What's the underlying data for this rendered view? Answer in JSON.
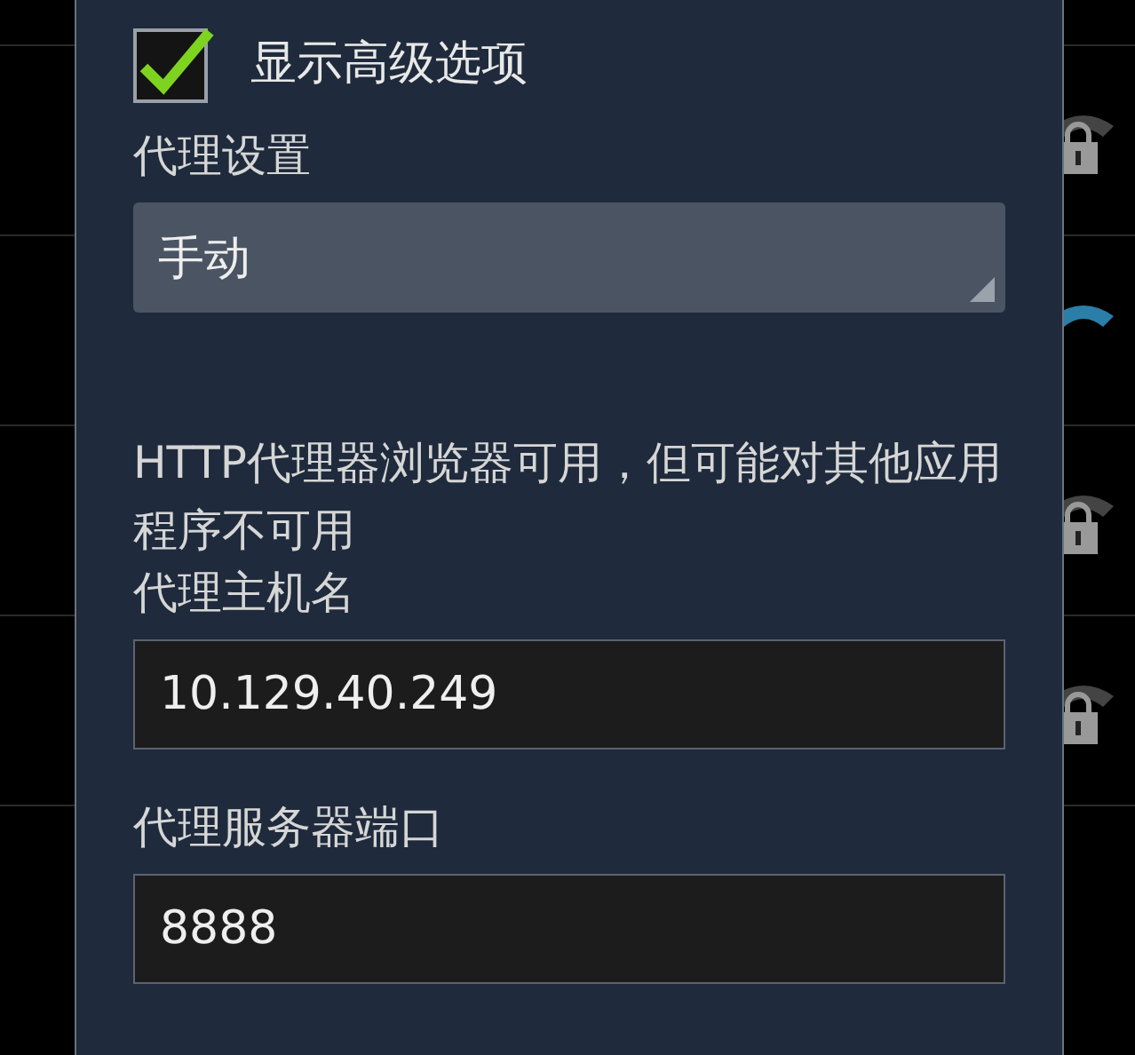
{
  "background_networks": [
    {
      "in_range": true,
      "secured": true,
      "connected": false
    },
    {
      "in_range": true,
      "secured": false,
      "connected": true
    },
    {
      "in_range": true,
      "secured": true,
      "connected": false
    },
    {
      "in_range": true,
      "secured": true,
      "connected": false
    },
    {
      "in_range": false
    }
  ],
  "dialog": {
    "advanced_option": {
      "label": "显示高级选项",
      "checked": true
    },
    "proxy_label": "代理设置",
    "proxy_select": {
      "value": "手动"
    },
    "hint": "HTTP代理器浏览器可用，但可能对其他应用程序不可用",
    "fields": [
      {
        "label": "代理主机名",
        "value": "10.129.40.249"
      },
      {
        "label": "代理服务器端口",
        "value": "8888"
      }
    ]
  }
}
